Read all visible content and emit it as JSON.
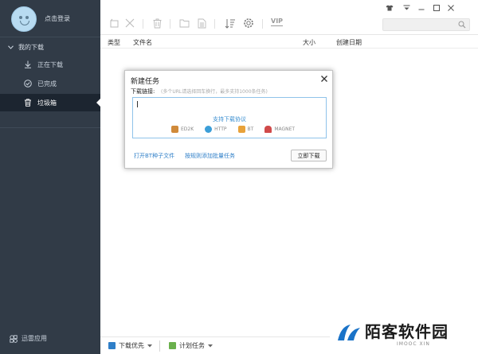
{
  "sidebar": {
    "login_label": "点击登录",
    "section_label": "我的下载",
    "items": [
      {
        "label": "正在下载",
        "icon": "download-arrow-icon"
      },
      {
        "label": "已完成",
        "icon": "check-circle-icon"
      },
      {
        "label": "垃圾箱",
        "icon": "trash-icon"
      }
    ],
    "apps_label": "迅雷应用"
  },
  "toolbar": {
    "vip_label": "VIP"
  },
  "columns": [
    "类型",
    "文件名",
    "大小",
    "创建日期"
  ],
  "dialog": {
    "title": "新建任务",
    "link_label": "下载链接:",
    "hint": "(多个URL请选择回车换行，最多支持1000条任务)",
    "support_label": "支持下载协议",
    "protocols": [
      "ED2K",
      "HTTP",
      "BT",
      "MAGNET"
    ],
    "open_torrent_label": "打开BT种子文件",
    "batch_label": "按规则添加批量任务",
    "download_now_label": "立即下载"
  },
  "statusbar": {
    "priority_label": "下载优先",
    "schedule_label": "计划任务"
  },
  "watermark": {
    "title": "陌客软件园",
    "subtitle": "IMOOC XIN"
  },
  "colors": {
    "sidebar_bg": "#313b47",
    "sidebar_active": "#1c2530",
    "accent_blue": "#2f7fc8",
    "watermark_blue": "#1a73c8"
  }
}
